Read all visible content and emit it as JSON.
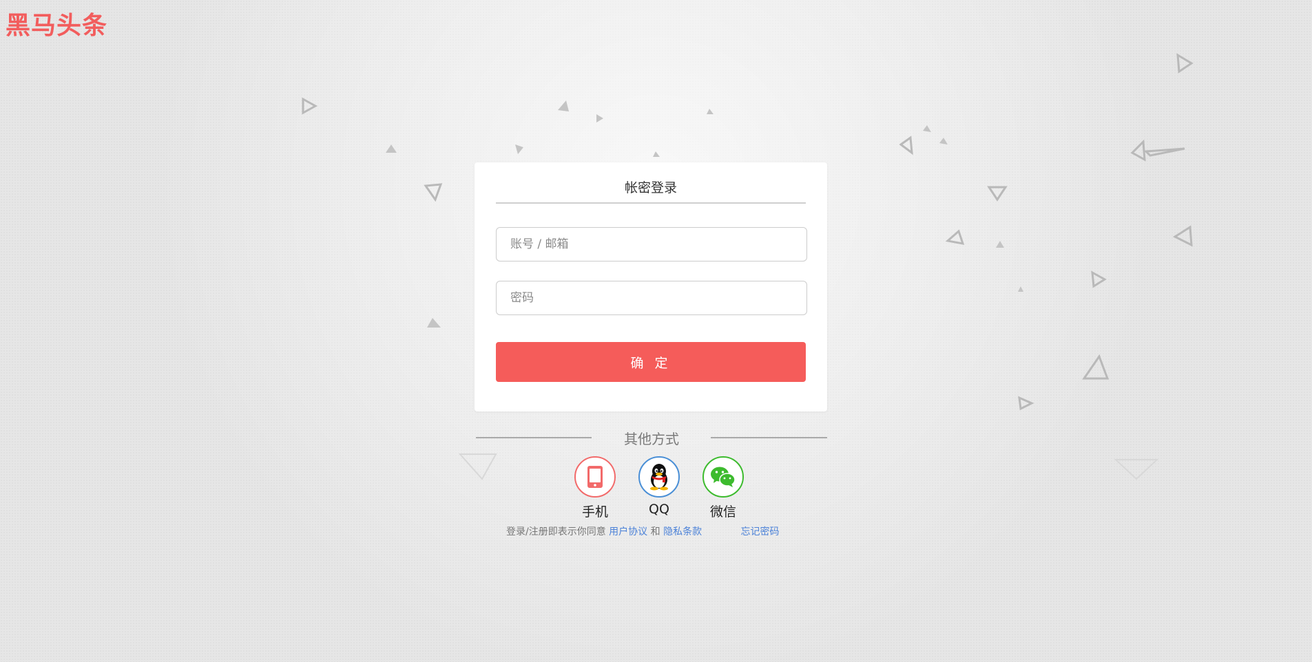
{
  "brand": {
    "logo_text": "黑马头条",
    "logo_color": "#f25d5d"
  },
  "login_card": {
    "title": "帐密登录",
    "account_placeholder": "账号 / 邮箱",
    "password_placeholder": "密码",
    "submit_label": "确 定",
    "submit_color": "#f55c5a"
  },
  "other_methods": {
    "heading": "其他方式",
    "items": [
      {
        "label": "手机",
        "icon": "phone-icon",
        "color": "#f26a6a"
      },
      {
        "label": "QQ",
        "icon": "qq-penguin-icon",
        "color": "#4a8fd6"
      },
      {
        "label": "微信",
        "icon": "wechat-icon",
        "color": "#3dbb2e"
      }
    ]
  },
  "footer": {
    "agree_text": "登录/注册即表示你同意",
    "terms_link": "用户协议",
    "and_text": "和",
    "privacy_link": "隐私条款",
    "forgot_link": "忘记密码",
    "link_color": "#4c82d8"
  }
}
